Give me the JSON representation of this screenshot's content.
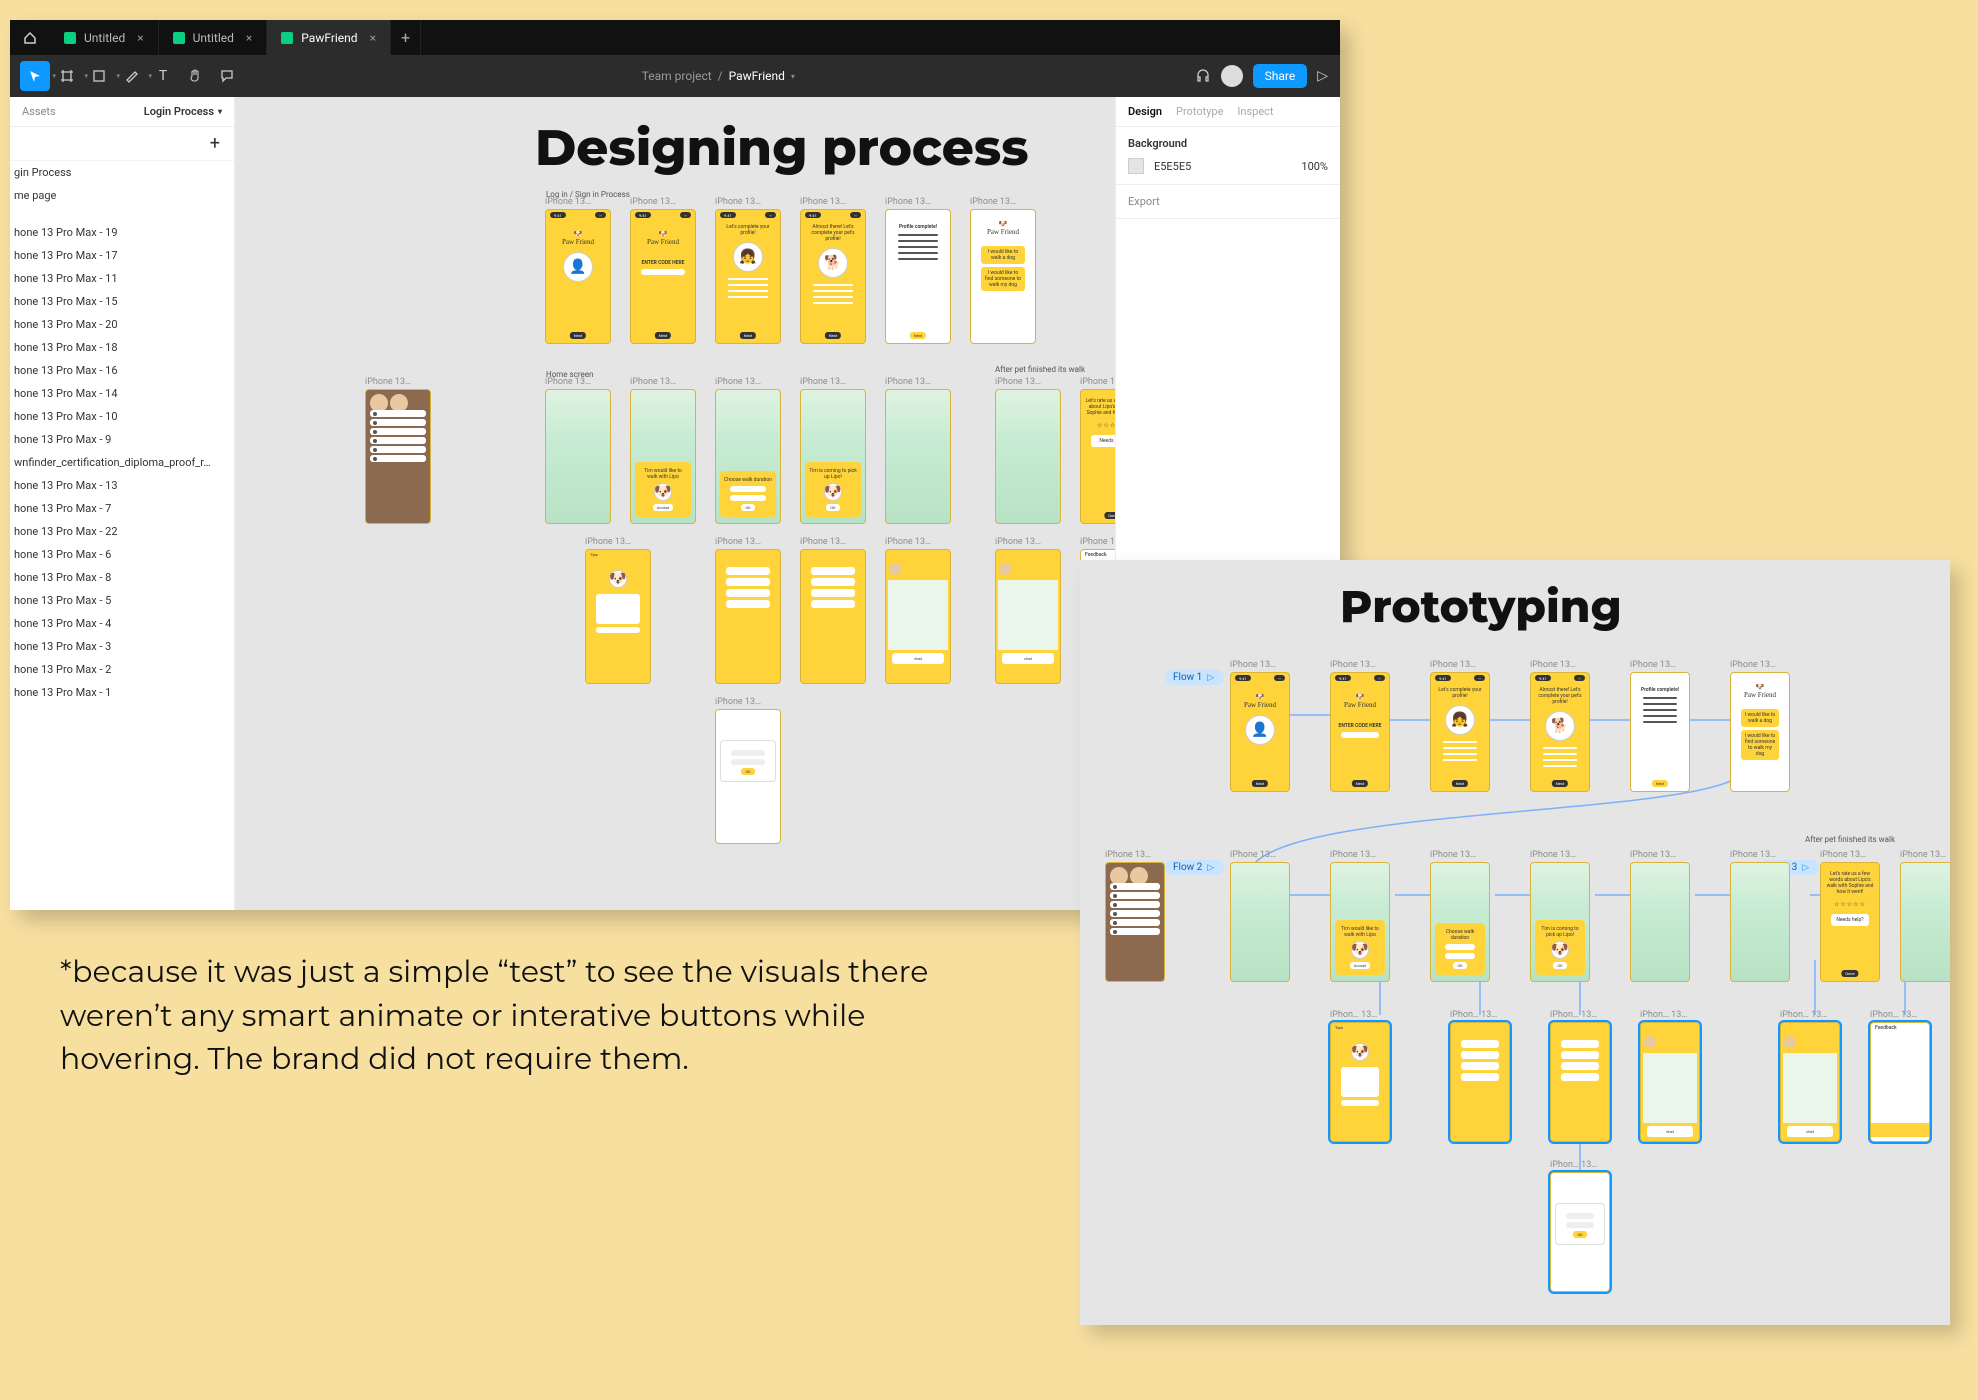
{
  "page_bg": "#f7dfa0",
  "caption": "*because it was just a simple “test” to see the visuals there weren’t any smart animate or interative buttons while hovering. The brand did not require them.",
  "figma": {
    "tabs": [
      {
        "label": "Untitled",
        "active": false
      },
      {
        "label": "Untitled",
        "active": false
      },
      {
        "label": "PawFriend",
        "active": true
      }
    ],
    "breadcrumb_team": "Team project",
    "breadcrumb_file": "PawFriend",
    "share_label": "Share",
    "left": {
      "assets_tab": "Assets",
      "current_page": "Login Process",
      "layers": [
        "gin Process",
        "me page",
        "",
        "hone 13 Pro Max - 19",
        "hone 13 Pro Max - 17",
        "hone 13 Pro Max - 11",
        "hone 13 Pro Max - 15",
        "hone 13 Pro Max - 20",
        "hone 13 Pro Max - 18",
        "hone 13 Pro Max - 16",
        "hone 13 Pro Max - 14",
        "hone 13 Pro Max - 10",
        "hone 13 Pro Max - 9",
        "wnfinder_certification_diploma_proof_r…",
        "hone 13 Pro Max - 13",
        "hone 13 Pro Max - 7",
        "hone 13 Pro Max - 22",
        "hone 13 Pro Max - 6",
        "hone 13 Pro Max - 8",
        "hone 13 Pro Max - 5",
        "hone 13 Pro Max - 4",
        "hone 13 Pro Max - 3",
        "hone 13 Pro Max - 2",
        "hone 13 Pro Max - 1"
      ]
    },
    "right": {
      "tab_design": "Design",
      "tab_prototype": "Prototype",
      "tab_inspect": "Inspect",
      "bg_header": "Background",
      "bg_hex": "E5E5E5",
      "bg_opacity": "100%",
      "export": "Export"
    },
    "canvas": {
      "heading": "Designing process",
      "frame_label": "iPhone 13…",
      "extra_label_r1": "Log in / Sign in Process",
      "extra_label_r2": "Home screen",
      "extra_label_r3": "After pet finished its walk",
      "texts": {
        "brand": "Paw Friend",
        "enter_code": "ENTER CODE HERE",
        "lets_complete": "Let's complete your profile!",
        "almost_there": "Almost there! Let's complete your pet's profile!",
        "profile_complete": "Profile complete!",
        "walk_dog": "I would like to walk a dog",
        "find_walker": "I would like to find someone to walk my dog",
        "tim_walk": "Tim would like to walk with Lipo",
        "choose_duration": "Choose walk duration",
        "tim_coming": "Tim is coming to pick up Lipo!",
        "tips": "Tips",
        "feedback": "Feedback",
        "after_walk": "Let's rate us a few words about Lipo's walk with Sophie and how it went!",
        "needs_help": "Needs help?"
      }
    }
  },
  "proto": {
    "heading": "Prototyping",
    "frame_label": "iPhone 13…",
    "frame_label_sel": "iPhon… 13…",
    "flow1": "Flow 1",
    "flow2": "Flow 2",
    "flow3": "Flow 3",
    "extra_label_r3": "After pet finished its walk"
  }
}
